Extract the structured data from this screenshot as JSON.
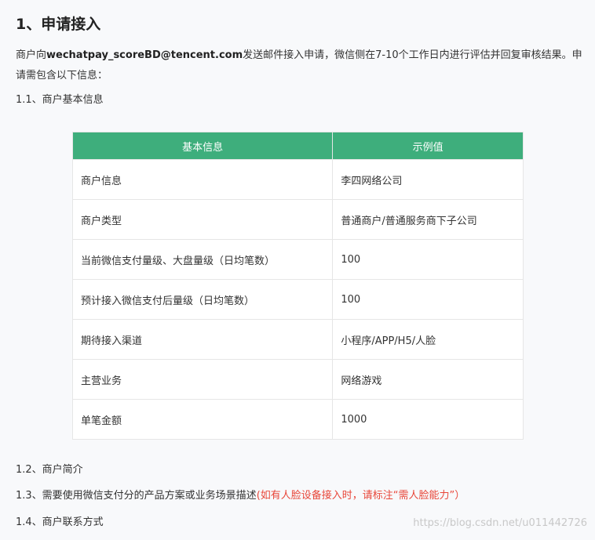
{
  "heading": "1、申请接入",
  "intro": {
    "prefix": "商户向",
    "email": "wechatpay_scoreBD@tencent.com",
    "suffix": "发送邮件接入申请，微信侧在7-10个工作日内进行评估并回复审核结果。申请需包含以下信息："
  },
  "sections": {
    "s1_1": "1.1、商户基本信息",
    "s1_2": "1.2、商户简介",
    "s1_3_text": "1.3、需要使用微信支付分的产品方案或业务场景描述",
    "s1_3_note": "(如有人脸设备接入时，请标注“需人脸能力”）",
    "s1_4": "1.4、商户联系方式"
  },
  "table": {
    "headers": [
      "基本信息",
      "示例值"
    ],
    "rows": [
      [
        "商户信息",
        "李四网络公司"
      ],
      [
        "商户类型",
        "普通商户/普通服务商下子公司"
      ],
      [
        "当前微信支付量级、大盘量级（日均笔数）",
        "100"
      ],
      [
        "预计接入微信支付后量级（日均笔数）",
        "100"
      ],
      [
        "期待接入渠道",
        "小程序/APP/H5/人脸"
      ],
      [
        "主营业务",
        "网络游戏"
      ],
      [
        "单笔金额",
        "1000"
      ]
    ]
  },
  "watermark": "https://blog.csdn.net/u011442726",
  "colors": {
    "header_bg": "#3eae7c",
    "note_red": "#e8473a",
    "page_bg": "#f8f9fb"
  }
}
